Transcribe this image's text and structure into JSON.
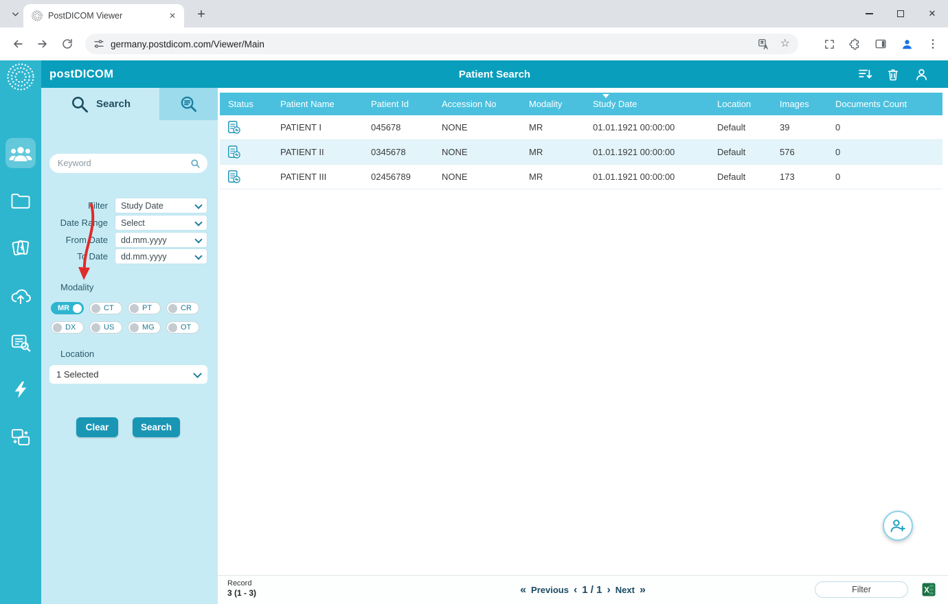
{
  "browser": {
    "tab_title": "PostDICOM Viewer",
    "url": "germany.postdicom.com/Viewer/Main",
    "glyphs": {
      "new_tab": "+",
      "tab_close": "✕",
      "window_close": "✕",
      "star": "☆",
      "menu": "⋮"
    }
  },
  "app": {
    "logo": "postDICOM",
    "title": "Patient Search"
  },
  "search_panel": {
    "tab_search_label": "Search",
    "keyword_placeholder": "Keyword",
    "filter": {
      "label": "Filter",
      "value": "Study Date"
    },
    "date_range": {
      "label": "Date Range",
      "value": "Select"
    },
    "from_date": {
      "label": "From Date",
      "value": "dd.mm.yyyy"
    },
    "to_date": {
      "label": "To Date",
      "value": "dd.mm.yyyy"
    },
    "modality_label": "Modality",
    "modalities": [
      {
        "label": "MR",
        "active": true
      },
      {
        "label": "CT",
        "active": false
      },
      {
        "label": "PT",
        "active": false
      },
      {
        "label": "CR",
        "active": false
      },
      {
        "label": "DX",
        "active": false
      },
      {
        "label": "US",
        "active": false
      },
      {
        "label": "MG",
        "active": false
      },
      {
        "label": "OT",
        "active": false
      }
    ],
    "location_label": "Location",
    "location_value": "1 Selected",
    "clear_label": "Clear",
    "search_label": "Search"
  },
  "table": {
    "columns": [
      "Status",
      "Patient Name",
      "Patient Id",
      "Accession No",
      "Modality",
      "Study Date",
      "Location",
      "Images",
      "Documents Count"
    ],
    "sorted_column": "Study Date",
    "rows": [
      {
        "patient_name": "PATIENT I",
        "patient_id": "045678",
        "accession_no": "NONE",
        "modality": "MR",
        "study_date": "01.01.1921 00:00:00",
        "location": "Default",
        "images": "39",
        "documents_count": "0"
      },
      {
        "patient_name": "PATIENT II",
        "patient_id": "0345678",
        "accession_no": "NONE",
        "modality": "MR",
        "study_date": "01.01.1921 00:00:00",
        "location": "Default",
        "images": "576",
        "documents_count": "0"
      },
      {
        "patient_name": "PATIENT III",
        "patient_id": "02456789",
        "accession_no": "NONE",
        "modality": "MR",
        "study_date": "01.01.1921 00:00:00",
        "location": "Default",
        "images": "173",
        "documents_count": "0"
      }
    ]
  },
  "footer": {
    "record_label": "Record",
    "record_value": "3 (1 - 3)",
    "previous": "Previous",
    "next": "Next",
    "page": "1 / 1",
    "filter_button": "Filter",
    "icons": {
      "first": "«",
      "prev": "‹",
      "nextg": "›",
      "last": "»"
    }
  },
  "icons": [
    "search-icon",
    "advanced-search-icon",
    "users-icon",
    "folder-icon",
    "documents-icon",
    "cloud-upload-icon",
    "list-search-icon",
    "share-icon",
    "transfer-icon",
    "sort-icon",
    "trash-icon",
    "user-icon",
    "person-add-icon",
    "excel-icon",
    "status-report-icon",
    "red-annotation-arrow"
  ],
  "colors": {
    "header": "#0A9EBD",
    "rail": "#2FB6CF",
    "panel": "#C7EBF4",
    "table_header": "#4BC0DE",
    "row_alt": "#E3F4FA",
    "button": "#1A96B5",
    "pagination": "#1A4A63",
    "annotation_red": "#E12B2B",
    "excel_green": "#1E7145",
    "avatar_blue": "#1A73E8"
  }
}
